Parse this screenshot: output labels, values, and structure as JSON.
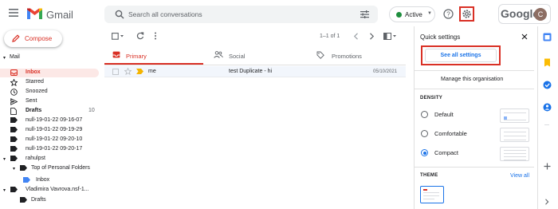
{
  "header": {
    "app_name": "Gmail",
    "search_placeholder": "Search all conversations",
    "status_label": "Active",
    "google_label": "Google",
    "avatar_initial": "C"
  },
  "sidebar": {
    "compose_label": "Compose",
    "mail_section": "Mail",
    "items": [
      {
        "label": "Inbox",
        "count": "",
        "icon": "inbox-icon"
      },
      {
        "label": "Starred",
        "count": "",
        "icon": "star-icon"
      },
      {
        "label": "Snoozed",
        "count": "",
        "icon": "clock-icon"
      },
      {
        "label": "Sent",
        "count": "",
        "icon": "send-icon"
      },
      {
        "label": "Drafts",
        "count": "10",
        "icon": "draft-icon"
      },
      {
        "label": "null-19-01-22 09-16-07",
        "count": "",
        "icon": "label-icon"
      },
      {
        "label": "null-19-01-22 09-19-29",
        "count": "",
        "icon": "label-icon"
      },
      {
        "label": "null-19-01-22 09-20-10",
        "count": "",
        "icon": "label-icon"
      },
      {
        "label": "null-19-01-22 09-20-17",
        "count": "",
        "icon": "label-icon"
      },
      {
        "label": "rahulpst",
        "count": "",
        "icon": "label-icon"
      },
      {
        "label": "Top of Personal Folders",
        "count": "",
        "icon": "label-icon"
      },
      {
        "label": "Inbox",
        "count": "",
        "icon": "label-icon"
      },
      {
        "label": "Vladimira Vavrova.nsf-1...",
        "count": "",
        "icon": "label-icon"
      },
      {
        "label": "Drafts",
        "count": "",
        "icon": "label-icon"
      }
    ]
  },
  "toolbar": {
    "pagination": "1–1 of 1"
  },
  "tabs": [
    {
      "label": "Primary",
      "icon": "inbox-icon"
    },
    {
      "label": "Social",
      "icon": "people-icon"
    },
    {
      "label": "Promotions",
      "icon": "tag-icon"
    }
  ],
  "emails": [
    {
      "sender": "me",
      "subject": "test Duplicate - hi",
      "date": "05/10/2021"
    }
  ],
  "quick_settings": {
    "title": "Quick settings",
    "see_all_label": "See all settings",
    "manage_label": "Manage this organisation",
    "density_heading": "DENSITY",
    "density_options": [
      "Default",
      "Comfortable",
      "Compact"
    ],
    "density_selected": "Compact",
    "theme_heading": "THEME",
    "view_all_label": "View all"
  },
  "colors": {
    "accent_red": "#d93025",
    "link_blue": "#1a73e8",
    "active_green": "#1e8e3e"
  }
}
